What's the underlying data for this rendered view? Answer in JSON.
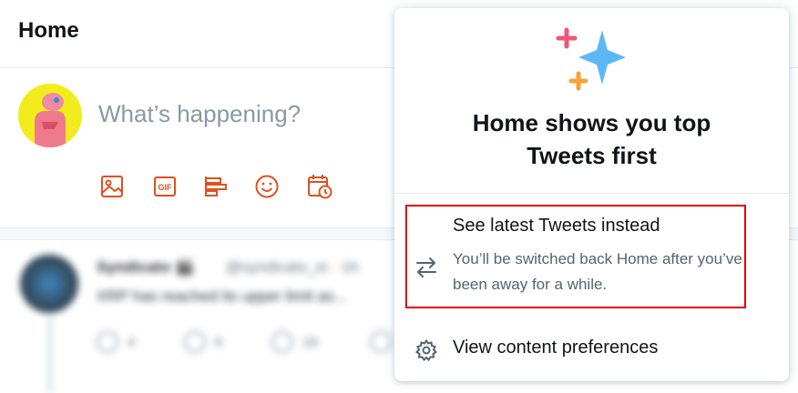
{
  "header": {
    "title": "Home"
  },
  "composer": {
    "placeholder": "What’s happening?",
    "tools": [
      {
        "icon": "image-icon"
      },
      {
        "icon": "gif-icon",
        "label": "GIF"
      },
      {
        "icon": "poll-icon"
      },
      {
        "icon": "emoji-icon"
      },
      {
        "icon": "schedule-icon"
      }
    ]
  },
  "timeline": {
    "blurred_tweet": {
      "name": "Syndicato 🎬",
      "handle": "@syndicato_io · 1h",
      "text": "XRP has reached its upper limit as...",
      "counts": [
        "4",
        "6",
        "18"
      ]
    }
  },
  "popover": {
    "title_line1": "Home shows you top",
    "title_line2": "Tweets first",
    "option_latest": {
      "label": "See latest Tweets instead",
      "description": "You’ll be switched back Home after you’ve been away for a while.",
      "icon": "swap-arrows-icon"
    },
    "option_prefs": {
      "label": "View content preferences",
      "icon": "gear-icon"
    }
  },
  "colors": {
    "accent": "#e0501e",
    "sparkle_blue": "#5bb8f5",
    "sparkle_pink": "#f0557a",
    "sparkle_orange": "#f7a23b",
    "highlight": "#e0000a"
  }
}
